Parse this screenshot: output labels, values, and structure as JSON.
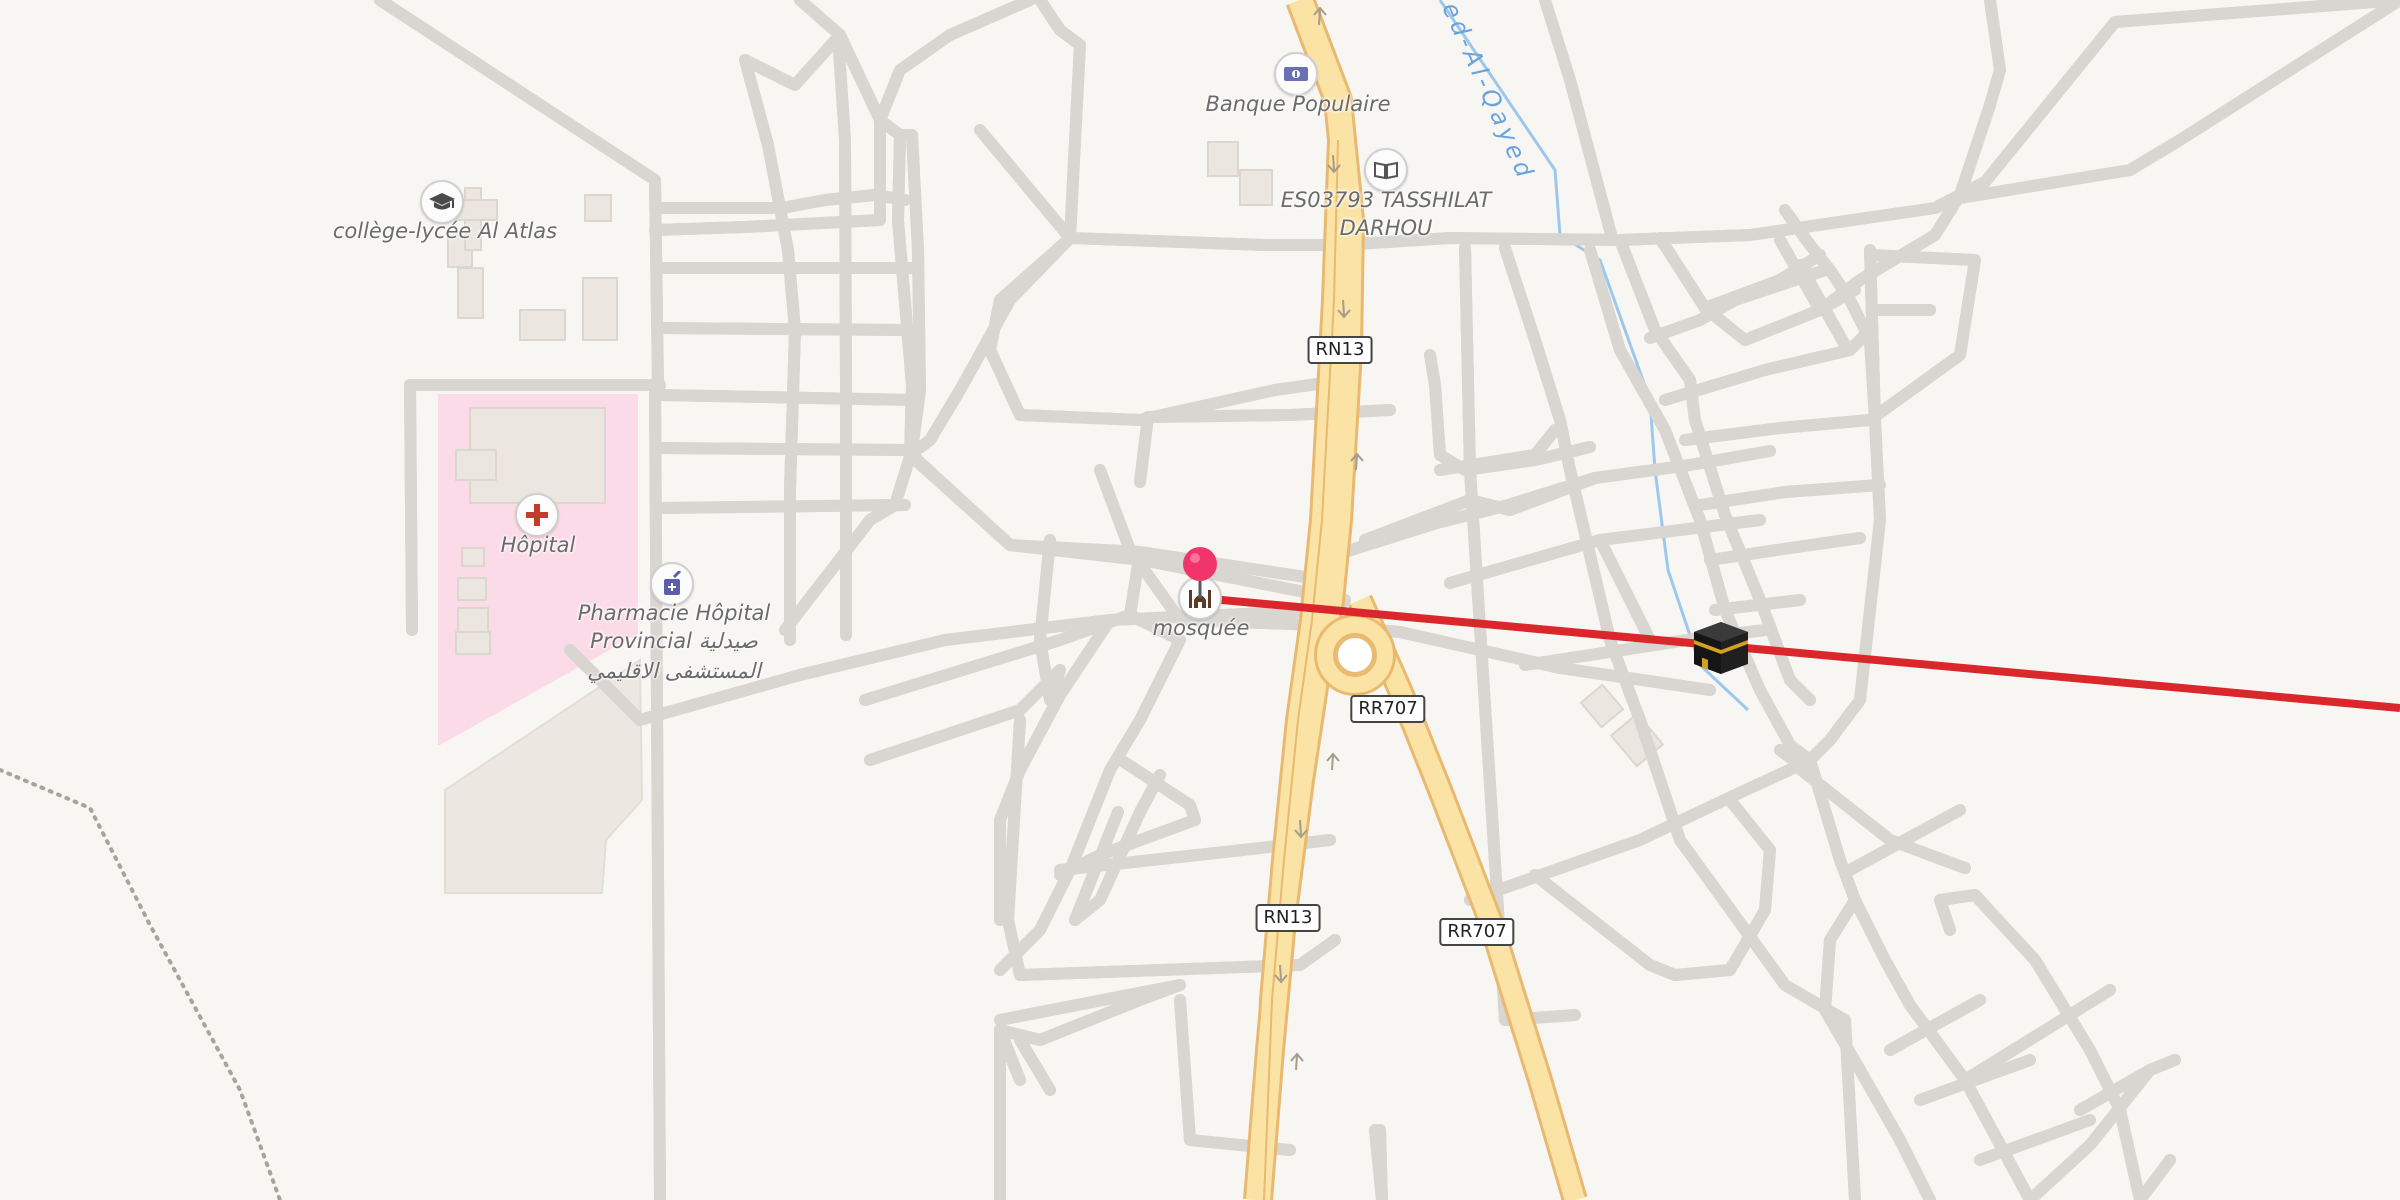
{
  "map": {
    "labels": {
      "bank": "Banque Populaire",
      "library_line1": "ES03793 TASSHILAT",
      "library_line2": "DARHOU",
      "school": "collège-lycée Al Atlas",
      "hospital": "Hôpital",
      "pharmacy_line1": "Pharmacie Hôpital",
      "pharmacy_line2": "Provincial صيدلية",
      "pharmacy_line3": "المستشفى الاقليمي",
      "mosque": "mosquée",
      "river": "ed-Al-Qayed"
    },
    "road_shields": {
      "rn13_top": "RN13",
      "rr707_upper": "RR707",
      "rn13_bottom": "RN13",
      "rr707_lower": "RR707"
    },
    "icons": {
      "bank": "bank-icon",
      "library": "book-icon",
      "school": "graduation-cap-icon",
      "hospital": "medical-cross-icon",
      "pharmacy": "pharmacy-mortar-icon",
      "mosque": "mosque-icon",
      "pin": "location-pin-icon",
      "qibla_target": "kaaba-icon"
    },
    "colors": {
      "background": "#f8f6f3",
      "street": "#ffffff",
      "street_casing": "#d9d6d1",
      "trunk_road": "#fbe3a5",
      "trunk_casing": "#e8b96e",
      "hospital_area": "#fcdbe8",
      "building": "#ece7e1",
      "water": "#9cc8ee",
      "qibla_line": "#d9272c",
      "pin": "#f0356b"
    }
  }
}
